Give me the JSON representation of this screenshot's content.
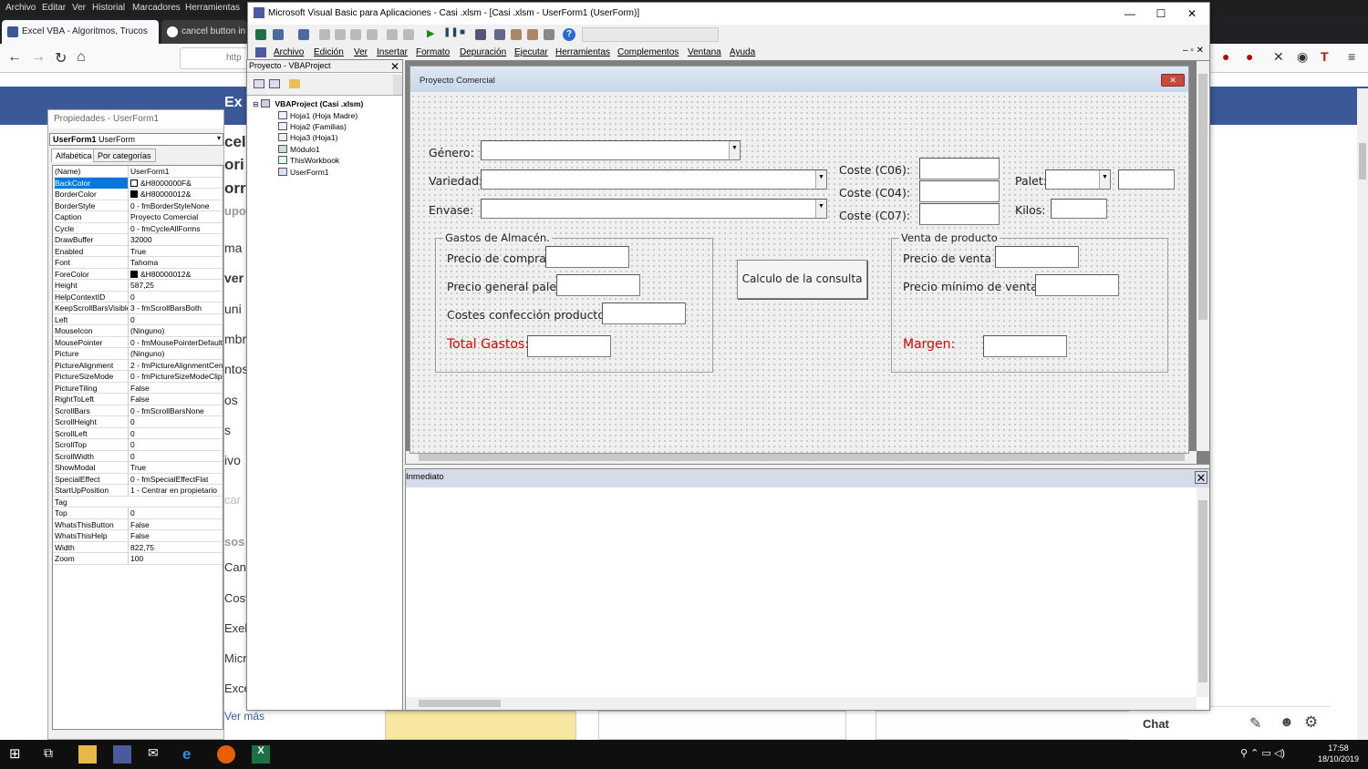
{
  "firefox": {
    "menu": [
      "Archivo",
      "Editar",
      "Ver",
      "Historial",
      "Marcadores",
      "Herramientas"
    ],
    "tabs": [
      {
        "label": "Excel VBA - Algoritmos, Trucos"
      },
      {
        "label": "cancel button in"
      }
    ],
    "url_text": "http",
    "page_words": [
      "Ex",
      "cel",
      "ori",
      "orr",
      "upo",
      "ma",
      "ver",
      "uni",
      "mbr",
      "ntos",
      "os",
      "s",
      "ivo",
      "car",
      "sos",
      "Canc",
      "Cost",
      "Exel",
      "Micro",
      "Exce",
      "Ver más"
    ],
    "chat_label": "Chat"
  },
  "taskbar": {
    "time": "17:58",
    "date": "18/10/2019"
  },
  "properties": {
    "title": "Propiedades - UserForm1",
    "object_name": "UserForm1",
    "object_type": "UserForm",
    "tabs": [
      "Alfabética",
      "Por categorías"
    ],
    "rows": [
      {
        "name": "(Name)",
        "value": "UserForm1"
      },
      {
        "name": "BackColor",
        "value": "&H8000000F&",
        "swatch": "#ffffff"
      },
      {
        "name": "BorderColor",
        "value": "&H80000012&",
        "swatch": "#000000"
      },
      {
        "name": "BorderStyle",
        "value": "0 - fmBorderStyleNone"
      },
      {
        "name": "Caption",
        "value": "Proyecto Comercial"
      },
      {
        "name": "Cycle",
        "value": "0 - fmCycleAllForms"
      },
      {
        "name": "DrawBuffer",
        "value": "32000"
      },
      {
        "name": "Enabled",
        "value": "True"
      },
      {
        "name": "Font",
        "value": "Tahoma"
      },
      {
        "name": "ForeColor",
        "value": "&H80000012&",
        "swatch": "#000000"
      },
      {
        "name": "Height",
        "value": "587,25"
      },
      {
        "name": "HelpContextID",
        "value": "0"
      },
      {
        "name": "KeepScrollBarsVisible",
        "value": "3 - fmScrollBarsBoth"
      },
      {
        "name": "Left",
        "value": "0"
      },
      {
        "name": "MouseIcon",
        "value": "(Ninguno)"
      },
      {
        "name": "MousePointer",
        "value": "0 - fmMousePointerDefault"
      },
      {
        "name": "Picture",
        "value": "(Ninguno)"
      },
      {
        "name": "PictureAlignment",
        "value": "2 - fmPictureAlignmentCente"
      },
      {
        "name": "PictureSizeMode",
        "value": "0 - fmPictureSizeModeClip"
      },
      {
        "name": "PictureTiling",
        "value": "False"
      },
      {
        "name": "RightToLeft",
        "value": "False"
      },
      {
        "name": "ScrollBars",
        "value": "0 - fmScrollBarsNone"
      },
      {
        "name": "ScrollHeight",
        "value": "0"
      },
      {
        "name": "ScrollLeft",
        "value": "0"
      },
      {
        "name": "ScrollTop",
        "value": "0"
      },
      {
        "name": "ScrollWidth",
        "value": "0"
      },
      {
        "name": "ShowModal",
        "value": "True"
      },
      {
        "name": "SpecialEffect",
        "value": "0 - fmSpecialEffectFlat"
      },
      {
        "name": "StartUpPosition",
        "value": "1 - Centrar en propietario"
      },
      {
        "name": "Tag",
        "value": ""
      },
      {
        "name": "Top",
        "value": "0"
      },
      {
        "name": "WhatsThisButton",
        "value": "False"
      },
      {
        "name": "WhatsThisHelp",
        "value": "False"
      },
      {
        "name": "Width",
        "value": "822,75"
      },
      {
        "name": "Zoom",
        "value": "100"
      }
    ]
  },
  "vba": {
    "title": "Microsoft Visual Basic para Aplicaciones - Casi .xlsm - [Casi .xlsm - UserForm1 (UserForm)]",
    "menu": [
      "Archivo",
      "Edición",
      "Ver",
      "Insertar",
      "Formato",
      "Depuración",
      "Ejecutar",
      "Herramientas",
      "Complementos",
      "Ventana",
      "Ayuda"
    ],
    "project": {
      "title": "Proyecto - VBAProject",
      "root": "VBAProject (Casi .xlsm)",
      "items": [
        "Hoja1 (Hoja Madre)",
        "Hoja2 (Familias)",
        "Hoja3 (Hoja1)",
        "Módulo1",
        "ThisWorkbook",
        "UserForm1"
      ]
    },
    "immediate_title": "Inmediato"
  },
  "form": {
    "caption": "Proyecto Comercial",
    "labels": {
      "genero": "Género:",
      "variedad": "Variedad:",
      "envase": "Envase:",
      "coste_c06": "Coste (C06):",
      "coste_c04": "Coste (C04):",
      "coste_c07": "Coste (C07):",
      "palet": "Palet:",
      "kilos": "Kilos:"
    },
    "gastos_frame": {
      "caption": "Gastos de Almacén.",
      "precio_compra": "Precio de compra :",
      "precio_general": "Precio general palet :",
      "costes_confeccion": "Costes confección producto :",
      "total_gastos": "Total Gastos:"
    },
    "venta_frame": {
      "caption": "Venta de producto",
      "precio_venta": "Precio de venta :",
      "precio_minimo": "Precio mínimo de venta:",
      "margen": "Margen:"
    },
    "button_calc": "Calculo de la consulta",
    "accent_red": "#e00000"
  }
}
